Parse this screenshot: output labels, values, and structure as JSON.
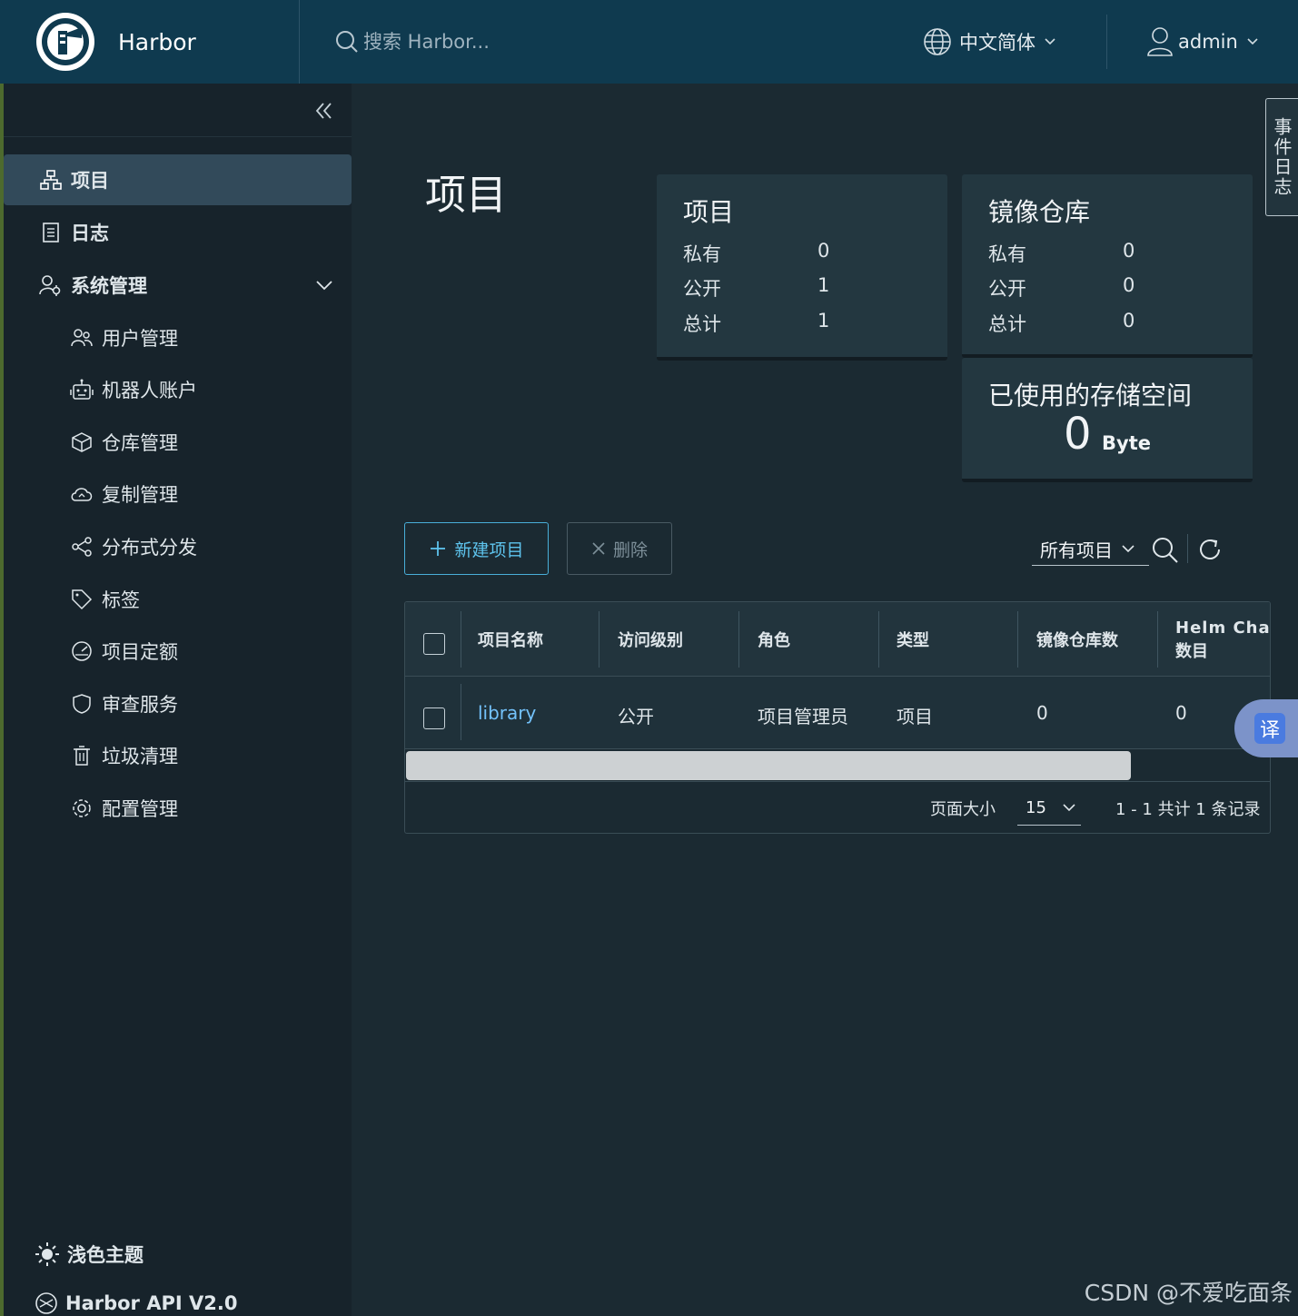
{
  "header": {
    "app_name": "Harbor",
    "search_placeholder": "搜索 Harbor...",
    "language": "中文简体",
    "user": "admin"
  },
  "sidebar": {
    "items": [
      {
        "label": "项目",
        "icon": "projects-icon"
      },
      {
        "label": "日志",
        "icon": "logs-icon"
      },
      {
        "label": "系统管理",
        "icon": "admin-icon"
      }
    ],
    "sub_items": [
      {
        "label": "用户管理",
        "icon": "users-icon"
      },
      {
        "label": "机器人账户",
        "icon": "robot-icon"
      },
      {
        "label": "仓库管理",
        "icon": "cube-icon"
      },
      {
        "label": "复制管理",
        "icon": "cloud-sync-icon"
      },
      {
        "label": "分布式分发",
        "icon": "share-icon"
      },
      {
        "label": "标签",
        "icon": "tag-icon"
      },
      {
        "label": "项目定额",
        "icon": "gauge-icon"
      },
      {
        "label": "审查服务",
        "icon": "shield-icon"
      },
      {
        "label": "垃圾清理",
        "icon": "trash-icon"
      },
      {
        "label": "配置管理",
        "icon": "gear-icon"
      }
    ],
    "theme": "浅色主题",
    "api": "Harbor API V2.0"
  },
  "main": {
    "title": "项目",
    "projects_card": {
      "title": "项目",
      "rows": [
        {
          "label": "私有",
          "value": "0"
        },
        {
          "label": "公开",
          "value": "1"
        },
        {
          "label": "总计",
          "value": "1"
        }
      ]
    },
    "repos_card": {
      "title": "镜像仓库",
      "rows": [
        {
          "label": "私有",
          "value": "0"
        },
        {
          "label": "公开",
          "value": "0"
        },
        {
          "label": "总计",
          "value": "0"
        }
      ]
    },
    "storage_card": {
      "title": "已使用的存储空间",
      "value": "0",
      "unit": "Byte"
    },
    "toolbar": {
      "new_label": "新建项目",
      "delete_label": "删除",
      "filter": "所有项目"
    },
    "table": {
      "columns": [
        "项目名称",
        "访问级别",
        "角色",
        "类型",
        "镜像仓库数",
        "Helm Chart",
        "数目"
      ],
      "rows": [
        [
          "library",
          "公开",
          "项目管理员",
          "项目",
          "0",
          "0"
        ]
      ]
    },
    "pager": {
      "size_label": "页面大小",
      "size": "15",
      "summary": "1 - 1 共计 1 条记录"
    }
  },
  "event_log": "事件日志",
  "translate_label": "译",
  "watermark": "CSDN @不爱吃面条",
  "colors": {
    "header_bg": "#0f3a4f",
    "sidebar_bg": "#17232b",
    "main_bg": "#1b2a32",
    "accent": "#49afd9",
    "link": "#73c2fb"
  }
}
